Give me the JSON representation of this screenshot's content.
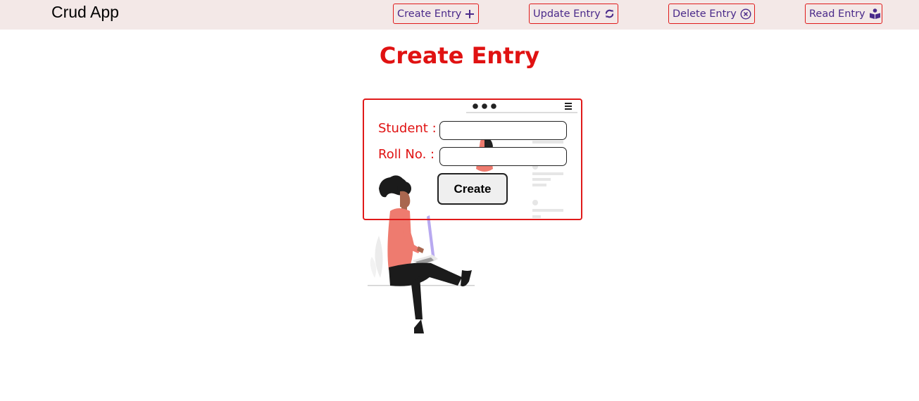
{
  "navbar": {
    "brand": "Crud App",
    "buttons": [
      {
        "label": "Create Entry",
        "icon": "plus-icon"
      },
      {
        "label": "Update Entry",
        "icon": "refresh-icon"
      },
      {
        "label": "Delete Entry",
        "icon": "circle-x-icon"
      },
      {
        "label": "Read Entry",
        "icon": "book-reader-icon"
      }
    ]
  },
  "page": {
    "title": "Create Entry"
  },
  "form": {
    "student_label": "Student :",
    "student_value": "",
    "roll_label": "Roll No. :",
    "roll_value": "",
    "submit_label": "Create"
  },
  "colors": {
    "accent_red": "#e01212",
    "nav_text": "#4a2a8a",
    "navbar_bg": "#f3e8e7",
    "figure_shirt": "#ee7b6f"
  }
}
